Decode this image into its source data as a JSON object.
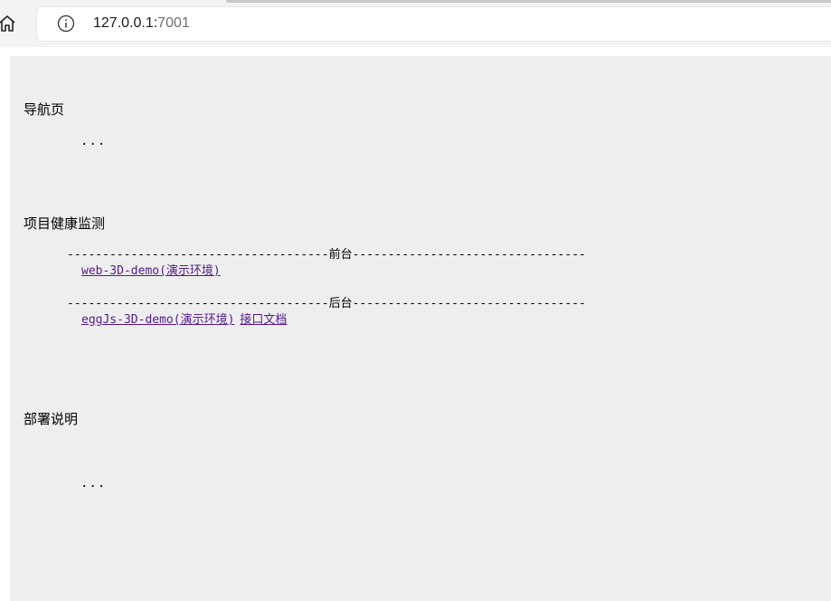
{
  "browser": {
    "home_icon": "home-icon",
    "info_icon": "info-icon",
    "url_host": "127.0.0.1:",
    "url_port": "7001"
  },
  "nav": {
    "title": "导航页",
    "content": "..."
  },
  "health": {
    "title": "项目健康监测",
    "frontend_divider": "-------------------------------------前台---------------------------------",
    "frontend_links": [
      "web-3D-demo(演示环境)"
    ],
    "backend_divider": "-------------------------------------后台---------------------------------",
    "backend_links": [
      "eggJs-3D-demo(演示环境)",
      "接口文档"
    ]
  },
  "deploy": {
    "title": "部署说明",
    "content": "..."
  },
  "colors": {
    "page_bg": "#eeeeee",
    "link_visited": "#551a8b",
    "chrome_bg": "#f3f3f3"
  }
}
